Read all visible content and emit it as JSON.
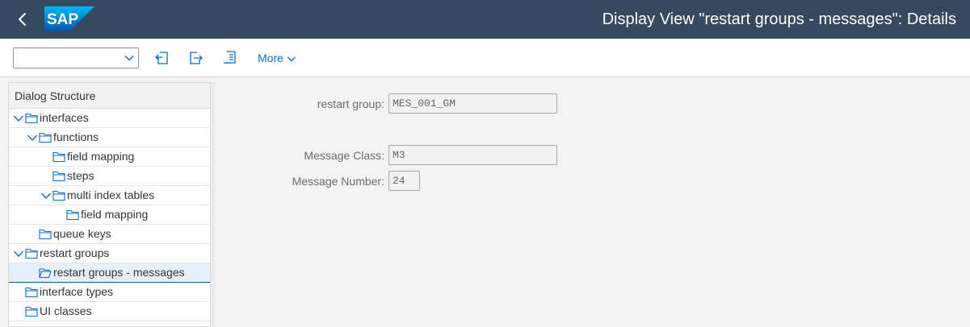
{
  "shell": {
    "title": "Display View \"restart groups - messages\": Details",
    "logo_text": "SAP",
    "back_icon": "back-arrow-icon"
  },
  "toolbar": {
    "select_value": "",
    "more_label": "More",
    "icons": [
      "first-entry-icon",
      "export-icon",
      "document-list-icon"
    ]
  },
  "sidebar": {
    "header": "Dialog Structure",
    "items": [
      {
        "label": "interfaces",
        "level": 0,
        "expanded": true
      },
      {
        "label": "functions",
        "level": 1,
        "expanded": true
      },
      {
        "label": "field mapping",
        "level": 2,
        "expanded": false
      },
      {
        "label": "steps",
        "level": 2,
        "expanded": false
      },
      {
        "label": "multi index tables",
        "level": 2,
        "expanded": true
      },
      {
        "label": "field mapping",
        "level": 3,
        "expanded": false
      },
      {
        "label": "queue keys",
        "level": 1,
        "expanded": false
      },
      {
        "label": "restart groups",
        "level": 0,
        "expanded": true
      },
      {
        "label": "restart groups - messages",
        "level": 1,
        "expanded": false,
        "selected": true
      },
      {
        "label": "interface types",
        "level": 0,
        "expanded": false
      },
      {
        "label": "UI classes",
        "level": 0,
        "expanded": false
      }
    ]
  },
  "form": {
    "restart_group_label": "restart group:",
    "restart_group_value": "MES_001_GM",
    "message_class_label": "Message Class:",
    "message_class_value": "M3",
    "message_number_label": "Message Number:",
    "message_number_value": "24"
  },
  "colors": {
    "shell_bg": "#354a5f",
    "accent": "#0a6ed1",
    "selected_row": "#e5f0fa",
    "page_bg": "#f3f3f3"
  }
}
